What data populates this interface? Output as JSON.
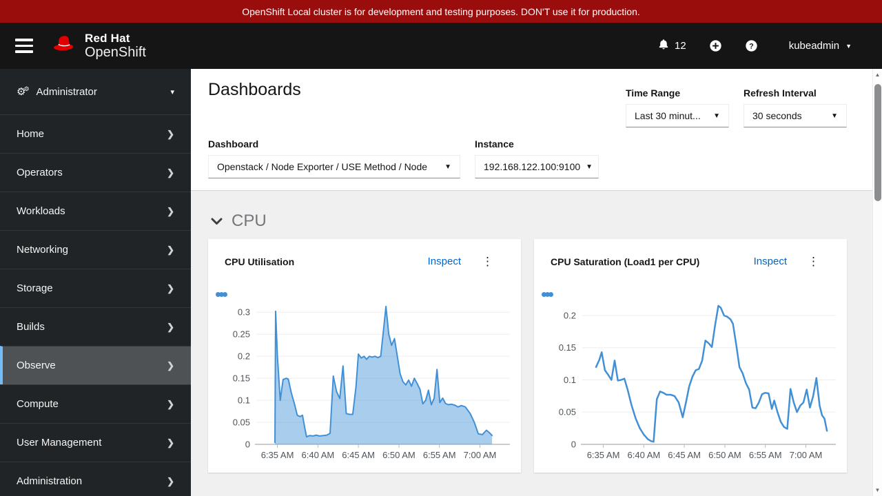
{
  "banner": {
    "text": "OpenShift Local cluster is for development and testing purposes. DON'T use it for production."
  },
  "masthead": {
    "brand_top": "Red Hat",
    "brand_bottom": "OpenShift",
    "notification_count": "12",
    "username": "kubeadmin"
  },
  "sidebar": {
    "perspective_label": "Administrator",
    "items": [
      {
        "label": "Home"
      },
      {
        "label": "Operators"
      },
      {
        "label": "Workloads"
      },
      {
        "label": "Networking"
      },
      {
        "label": "Storage"
      },
      {
        "label": "Builds"
      },
      {
        "label": "Observe",
        "active": true
      },
      {
        "label": "Compute"
      },
      {
        "label": "User Management"
      },
      {
        "label": "Administration"
      }
    ]
  },
  "page": {
    "title": "Dashboards"
  },
  "filters": {
    "time_range_label": "Time Range",
    "time_range_value": "Last 30 minut...",
    "refresh_label": "Refresh Interval",
    "refresh_value": "30 seconds",
    "dashboard_label": "Dashboard",
    "dashboard_value": "Openstack / Node Exporter / USE Method / Node",
    "instance_label": "Instance",
    "instance_value": "192.168.122.100:9100"
  },
  "section": {
    "title": "CPU"
  },
  "cards": [
    {
      "title": "CPU Utilisation",
      "action": "Inspect"
    },
    {
      "title": "CPU Saturation (Load1 per CPU)",
      "action": "Inspect"
    }
  ],
  "icons": {
    "hamburger": "hamburger-menu",
    "bell": "notification-bell",
    "plus_circle": "plus-circle",
    "help_circle": "question-circle",
    "cogs": "⚙",
    "caret_down": "▾",
    "user_caret": "▼",
    "chevron_right": "❯",
    "kebab": "⋮",
    "triangle_up": "▲",
    "triangle_down": "▼"
  },
  "colors": {
    "banner_red": "#9a0d0d",
    "link_blue": "#0066cc",
    "chart_blue": "#4190d6",
    "nav_accent": "#73bcf7",
    "masthead_bg": "#151515",
    "sidebar_bg": "#212427",
    "sidebar_active_bg": "#4f5255",
    "content_bg": "#f0f0f0"
  },
  "chart_data": [
    {
      "type": "area",
      "title": "CPU Utilisation",
      "xlabel": "time",
      "ylabel": "",
      "legend_position": "top-left-overflow-dots",
      "grid": true,
      "x_range": [
        392.4,
        423.7
      ],
      "x_ticks": [
        {
          "value": 395,
          "label": "6:35 AM"
        },
        {
          "value": 400,
          "label": "6:40 AM"
        },
        {
          "value": 405,
          "label": "6:45 AM"
        },
        {
          "value": 410,
          "label": "6:50 AM"
        },
        {
          "value": 415,
          "label": "6:55 AM"
        },
        {
          "value": 420,
          "label": "7:00 AM"
        }
      ],
      "y_plot_max": 0.316,
      "y_ticks": [
        {
          "value": 0,
          "label": "0"
        },
        {
          "value": 0.05,
          "label": "0.05"
        },
        {
          "value": 0.1,
          "label": "0.1"
        },
        {
          "value": 0.15,
          "label": "0.15"
        },
        {
          "value": 0.2,
          "label": "0.2"
        },
        {
          "value": 0.25,
          "label": "0.25"
        },
        {
          "value": 0.3,
          "label": "0.3"
        }
      ],
      "line_color": "#4190d6",
      "fill_color": "rgba(65,144,214,0.45)",
      "stroke_width": 2,
      "points": [
        [
          394.7,
          0.004
        ],
        [
          394.78,
          0.302
        ],
        [
          395.0,
          0.2
        ],
        [
          395.35,
          0.1
        ],
        [
          395.7,
          0.147
        ],
        [
          396.1,
          0.15
        ],
        [
          396.35,
          0.148
        ],
        [
          396.7,
          0.118
        ],
        [
          397.1,
          0.092
        ],
        [
          397.45,
          0.066
        ],
        [
          397.8,
          0.063
        ],
        [
          398.1,
          0.066
        ],
        [
          398.35,
          0.04
        ],
        [
          398.6,
          0.017
        ],
        [
          399.0,
          0.02
        ],
        [
          399.4,
          0.019
        ],
        [
          399.8,
          0.021
        ],
        [
          400.2,
          0.019
        ],
        [
          400.7,
          0.02
        ],
        [
          401.1,
          0.021
        ],
        [
          401.5,
          0.025
        ],
        [
          401.9,
          0.155
        ],
        [
          402.3,
          0.12
        ],
        [
          402.7,
          0.104
        ],
        [
          403.1,
          0.178
        ],
        [
          403.5,
          0.07
        ],
        [
          403.9,
          0.068
        ],
        [
          404.3,
          0.068
        ],
        [
          404.7,
          0.13
        ],
        [
          405.0,
          0.205
        ],
        [
          405.35,
          0.196
        ],
        [
          405.7,
          0.2
        ],
        [
          406.0,
          0.193
        ],
        [
          406.35,
          0.2
        ],
        [
          406.7,
          0.198
        ],
        [
          407.05,
          0.2
        ],
        [
          407.4,
          0.197
        ],
        [
          407.75,
          0.2
        ],
        [
          408.1,
          0.26
        ],
        [
          408.4,
          0.313
        ],
        [
          408.75,
          0.25
        ],
        [
          409.1,
          0.225
        ],
        [
          409.45,
          0.24
        ],
        [
          409.8,
          0.2
        ],
        [
          410.15,
          0.16
        ],
        [
          410.5,
          0.142
        ],
        [
          410.85,
          0.135
        ],
        [
          411.2,
          0.146
        ],
        [
          411.55,
          0.132
        ],
        [
          411.9,
          0.15
        ],
        [
          412.25,
          0.138
        ],
        [
          412.6,
          0.125
        ],
        [
          412.95,
          0.092
        ],
        [
          413.3,
          0.1
        ],
        [
          413.65,
          0.123
        ],
        [
          414.0,
          0.09
        ],
        [
          414.35,
          0.105
        ],
        [
          414.7,
          0.17
        ],
        [
          415.05,
          0.095
        ],
        [
          415.4,
          0.105
        ],
        [
          415.75,
          0.093
        ],
        [
          416.1,
          0.09
        ],
        [
          416.5,
          0.091
        ],
        [
          416.9,
          0.089
        ],
        [
          417.3,
          0.085
        ],
        [
          417.7,
          0.088
        ],
        [
          418.2,
          0.085
        ],
        [
          418.8,
          0.07
        ],
        [
          419.3,
          0.05
        ],
        [
          419.8,
          0.024
        ],
        [
          420.3,
          0.022
        ],
        [
          420.8,
          0.032
        ],
        [
          421.2,
          0.026
        ],
        [
          421.5,
          0.02
        ]
      ]
    },
    {
      "type": "line",
      "title": "CPU Saturation (Load1 per CPU)",
      "xlabel": "time",
      "ylabel": "",
      "legend_position": "top-left-overflow-dots",
      "grid": true,
      "x_range": [
        392.4,
        423.7
      ],
      "x_ticks": [
        {
          "value": 395,
          "label": "6:35 AM"
        },
        {
          "value": 400,
          "label": "6:40 AM"
        },
        {
          "value": 405,
          "label": "6:45 AM"
        },
        {
          "value": 410,
          "label": "6:50 AM"
        },
        {
          "value": 415,
          "label": "6:55 AM"
        },
        {
          "value": 420,
          "label": "7:00 AM"
        }
      ],
      "y_plot_max": 0.216,
      "y_ticks": [
        {
          "value": 0,
          "label": "0"
        },
        {
          "value": 0.05,
          "label": "0.05"
        },
        {
          "value": 0.1,
          "label": "0.1"
        },
        {
          "value": 0.15,
          "label": "0.15"
        },
        {
          "value": 0.2,
          "label": "0.2"
        }
      ],
      "line_color": "#4190d6",
      "fill_color": null,
      "stroke_width": 2.5,
      "points": [
        [
          394.1,
          0.12
        ],
        [
          394.5,
          0.131
        ],
        [
          394.8,
          0.143
        ],
        [
          395.2,
          0.115
        ],
        [
          395.6,
          0.108
        ],
        [
          396.0,
          0.1
        ],
        [
          396.4,
          0.13
        ],
        [
          396.8,
          0.099
        ],
        [
          397.2,
          0.1
        ],
        [
          397.6,
          0.102
        ],
        [
          398.0,
          0.085
        ],
        [
          398.5,
          0.06
        ],
        [
          399.0,
          0.04
        ],
        [
          399.5,
          0.025
        ],
        [
          400.0,
          0.015
        ],
        [
          400.5,
          0.008
        ],
        [
          400.9,
          0.005
        ],
        [
          401.2,
          0.004
        ],
        [
          401.6,
          0.07
        ],
        [
          402.0,
          0.082
        ],
        [
          402.4,
          0.08
        ],
        [
          402.8,
          0.077
        ],
        [
          403.3,
          0.077
        ],
        [
          403.8,
          0.075
        ],
        [
          404.3,
          0.065
        ],
        [
          404.8,
          0.042
        ],
        [
          405.2,
          0.065
        ],
        [
          405.6,
          0.09
        ],
        [
          406.0,
          0.105
        ],
        [
          406.4,
          0.115
        ],
        [
          406.8,
          0.117
        ],
        [
          407.2,
          0.13
        ],
        [
          407.6,
          0.161
        ],
        [
          408.0,
          0.157
        ],
        [
          408.4,
          0.151
        ],
        [
          408.8,
          0.185
        ],
        [
          409.2,
          0.215
        ],
        [
          409.5,
          0.212
        ],
        [
          409.9,
          0.2
        ],
        [
          410.3,
          0.198
        ],
        [
          410.7,
          0.194
        ],
        [
          411.0,
          0.187
        ],
        [
          411.4,
          0.155
        ],
        [
          411.8,
          0.12
        ],
        [
          412.2,
          0.11
        ],
        [
          412.6,
          0.095
        ],
        [
          413.0,
          0.085
        ],
        [
          413.4,
          0.057
        ],
        [
          413.8,
          0.056
        ],
        [
          414.2,
          0.065
        ],
        [
          414.6,
          0.078
        ],
        [
          415.0,
          0.08
        ],
        [
          415.4,
          0.079
        ],
        [
          415.8,
          0.055
        ],
        [
          416.1,
          0.068
        ],
        [
          416.5,
          0.05
        ],
        [
          416.9,
          0.035
        ],
        [
          417.3,
          0.027
        ],
        [
          417.7,
          0.024
        ],
        [
          418.1,
          0.086
        ],
        [
          418.5,
          0.065
        ],
        [
          418.9,
          0.05
        ],
        [
          419.3,
          0.06
        ],
        [
          419.7,
          0.065
        ],
        [
          420.1,
          0.085
        ],
        [
          420.5,
          0.057
        ],
        [
          420.9,
          0.075
        ],
        [
          421.3,
          0.103
        ],
        [
          421.7,
          0.06
        ],
        [
          422.0,
          0.045
        ],
        [
          422.3,
          0.04
        ],
        [
          422.6,
          0.021
        ]
      ]
    }
  ]
}
